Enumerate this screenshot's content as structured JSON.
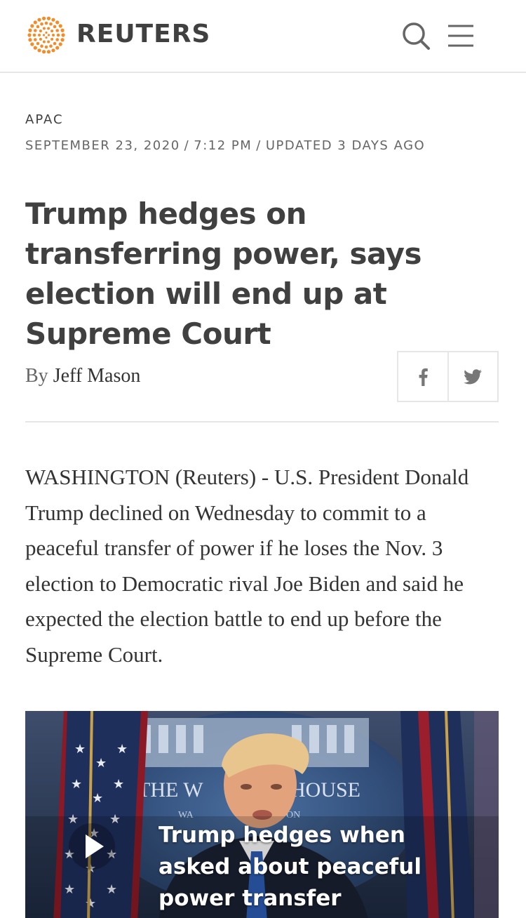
{
  "header": {
    "brand": "REUTERS",
    "logo_icon": "reuters-dot-logo",
    "search_icon": "search-icon",
    "menu_icon": "hamburger-menu-icon",
    "brand_color": "#f28c28"
  },
  "article": {
    "section": "APAC",
    "date": "SEPTEMBER 23, 2020",
    "time": "7:12 PM",
    "updated": "UPDATED 3 DAYS AGO",
    "headline": "Trump hedges on transferring power, says election will end up at Supreme Court",
    "byline_prefix": "By",
    "author": "Jeff Mason",
    "share": [
      "facebook-icon",
      "twitter-icon"
    ],
    "body": "WASHINGTON (Reuters) - U.S. President Donald Trump declined on Wednesday to commit to a peaceful transfer of power if he loses the Nov. 3 election to Democratic rival Joe Biden and said he expected the election battle to end up before the Supreme Court."
  },
  "video": {
    "title": "Trump hedges when asked about peaceful power transfer",
    "play_icon": "play-icon",
    "backdrop_text_left": "THE W",
    "backdrop_text_right": "HOUSE",
    "backdrop_text_small_left": "WA",
    "backdrop_text_small_right": "ON"
  }
}
